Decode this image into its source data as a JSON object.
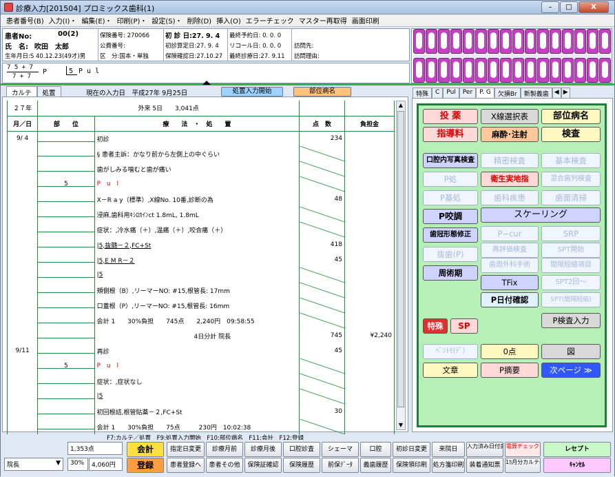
{
  "window": {
    "title": "診療入力[201504] プロミックス歯科(1)",
    "minimize": "–",
    "maximize": "□",
    "close": "X"
  },
  "menu": [
    "患者番号(B)",
    "入力(I)・",
    "編集(E)・",
    "印刷(P)・",
    "設定(S)・",
    "削除(D)",
    "挿入(O)",
    "エラーチェック",
    "マスター再取得",
    "画面印刷"
  ],
  "patient": {
    "no_label": "患者No:",
    "no_value": "00(2)",
    "name_label": "氏　名:",
    "name_value": "吹田　太郎",
    "birth": "生年月日:S 40.12.23(49才)男",
    "insurer_no": "保険番号:  270066",
    "public_no": "公費番号:",
    "category": "区　分:国本・単独",
    "first_visit": "初 診 日:27. 9. 4",
    "first_calc": "初診算定日:27. 9. 4",
    "ins_confirm": "保険確認日:27.10.27",
    "last_appoint": "最終予約日: 0. 0. 0",
    "recall": "リコール日: 0. 0. 0",
    "last_visit": "最終診療日:27. 9.11",
    "visit_place": "訪問先:",
    "visit_reason": "訪問理由:"
  },
  "formula": {
    "top": "7 5 + 7",
    "bottom": "7 + 7",
    "suffix": "P",
    "tooth": "5",
    "dx": "P u l"
  },
  "left_tabs": [
    "カルテ",
    "処置"
  ],
  "current_date": "現在の入力日　平成27年 9月25日",
  "btn_treatment_start": "処置入力開始",
  "btn_site_name": "部位病名",
  "karte": {
    "year": "２７年",
    "summary": "外来 5日　　3,041点",
    "headers": [
      "月／日",
      "部　　位",
      "療　　法　・　処　　置",
      "点　数",
      "負担金"
    ],
    "rows": [
      {
        "date": "9/ 4",
        "site": "",
        "text": "初診",
        "pts": "234",
        "fee": "",
        "style": ""
      },
      {
        "date": "",
        "site": "",
        "text": "§ 患者主訴：かなり前から左側上の中ぐらい",
        "pts": "",
        "fee": "",
        "style": ""
      },
      {
        "date": "",
        "site": "",
        "text": "歯がしみる噛むと歯が痛い",
        "pts": "",
        "fee": "",
        "style": ""
      },
      {
        "date": "",
        "site": "5",
        "text": "P u l",
        "pts": "",
        "fee": "",
        "style": "red"
      },
      {
        "date": "",
        "site": "",
        "text": "X－R a y（標準）,X線No. 10番,診断の為",
        "pts": "48",
        "fee": "",
        "style": ""
      },
      {
        "date": "",
        "site": "",
        "text": "浸麻,歯科用ｷｼﾛｶｲﾝct 1.8mL, 1.8mL",
        "pts": "",
        "fee": "",
        "style": ""
      },
      {
        "date": "",
        "site": "",
        "text": "症状：,冷水痛（＋）,温痛（＋）,咬合痛（＋）",
        "pts": "",
        "fee": "",
        "style": ""
      },
      {
        "date": "",
        "site": "",
        "text": "|5,抜髄－２,FC+St",
        "pts": "418",
        "fee": "",
        "style": "ul"
      },
      {
        "date": "",
        "site": "",
        "text": "|5,E M R－２",
        "pts": "45",
        "fee": "",
        "style": "ul"
      },
      {
        "date": "",
        "site": "",
        "text": "|5",
        "pts": "",
        "fee": "",
        "style": "ul"
      },
      {
        "date": "",
        "site": "",
        "text": "頬側根（B）,リーマーNO: #15,根管長: 17mm",
        "pts": "",
        "fee": "",
        "style": ""
      },
      {
        "date": "",
        "site": "",
        "text": "口蓋根（P）,リーマーNO: #15,根管長: 16mm",
        "pts": "",
        "fee": "",
        "style": ""
      },
      {
        "date": "",
        "site": "",
        "text": "会計 1　　30%負担　　745点　　2,240円　09:58:55",
        "pts": "",
        "fee": "",
        "style": ""
      },
      {
        "date": "",
        "site": "",
        "text": "　　　　　4日分計 院長",
        "pts": "745",
        "fee": "¥2,240",
        "style": "center"
      },
      {
        "date": "9/11",
        "site": "",
        "text": "再診",
        "pts": "45",
        "fee": "",
        "style": ""
      },
      {
        "date": "",
        "site": "5",
        "text": "P u l",
        "pts": "",
        "fee": "",
        "style": "red"
      },
      {
        "date": "",
        "site": "",
        "text": "症状：,症状なし",
        "pts": "",
        "fee": "",
        "style": ""
      },
      {
        "date": "",
        "site": "",
        "text": "|5",
        "pts": "",
        "fee": "",
        "style": "ul"
      },
      {
        "date": "",
        "site": "",
        "text": "初回根詰,根管貼薬－２,FC+St",
        "pts": "30",
        "fee": "",
        "style": ""
      },
      {
        "date": "",
        "site": "",
        "text": "会計 1　　30%負担　　75点　　　230円　10:02:38",
        "pts": "",
        "fee": "",
        "style": ""
      }
    ]
  },
  "function_keys": "F7:カルテ／処置　F9:処置入力開始　F10:部位病名　F11:会計　F12:登録",
  "right_tabs": [
    "特殊",
    "C",
    "Pul",
    "Per",
    "P. G",
    "欠損Br",
    "新製義歯"
  ],
  "right_buttons": {
    "toyaku": "投 薬",
    "xray": "X線選択表",
    "bui": "部位病名",
    "shido": "指導料",
    "masui": "麻酔･注射",
    "kensa": "検査",
    "koku": "口腔内写真検査",
    "seimitsu": "精密検査",
    "kihon": "基本検査",
    "psho": "P処",
    "eisei": "衛生実地指",
    "kongo": "混合歯列検査",
    "pki": "P基処",
    "shika": "歯科疾患",
    "shimen": "歯面清掃",
    "pkocho": "P咬調",
    "scaling": "スケーリング",
    "shikan": "歯冠形態修正",
    "pcur": "P−cur",
    "srp": "SRP",
    "basshi": "抜歯(P)",
    "sai": "再評価検査",
    "shishu": "歯周外科手術",
    "kankaku": "間隔短縮項目",
    "shujutsu": "周術期",
    "tfix": "TFix",
    "spt2": "SPT2回〜",
    "spt": "SPT開始",
    "phizuke": "P日付確認",
    "sptk": "SPT(間隔短縮)",
    "tokushu": "特殊",
    "sp": "SP",
    "pkensa": "P検査入力",
    "bento": "ﾍﾞﾝﾄﾓ(ﾃﾞ)",
    "zero": "0点",
    "zu": "図",
    "bunsho": "文章",
    "ptekiyo": "P摘要",
    "next": "次ページ ≫"
  },
  "bottom": {
    "points": "1,353点",
    "ratio": "30%",
    "amount": "4,060円",
    "doctor": "院長",
    "kaikei": "会計",
    "toroku": "登録",
    "row1": [
      "指定日変更",
      "診療月前",
      "診療月後",
      "口腔診査",
      "シェーマ",
      "口腔",
      "初診日変更",
      "来院日",
      "入力済み日付変更",
      "電算チェック",
      "レセプト"
    ],
    "row2": [
      "患者登録へ",
      "患者その他",
      "保険証確認",
      "保険履歴",
      "前保ﾃﾞｰﾀ",
      "義歯履歴",
      "保険領印刷",
      "処方箋印刷",
      "装着通知票",
      "1ｶ月分カルテ表示",
      "ｷｬﾝｾﾙ"
    ]
  },
  "colors": {
    "green_accent": "#1d7d3b",
    "panel_green": "#b6f0b6",
    "red_text": "#e00000"
  }
}
